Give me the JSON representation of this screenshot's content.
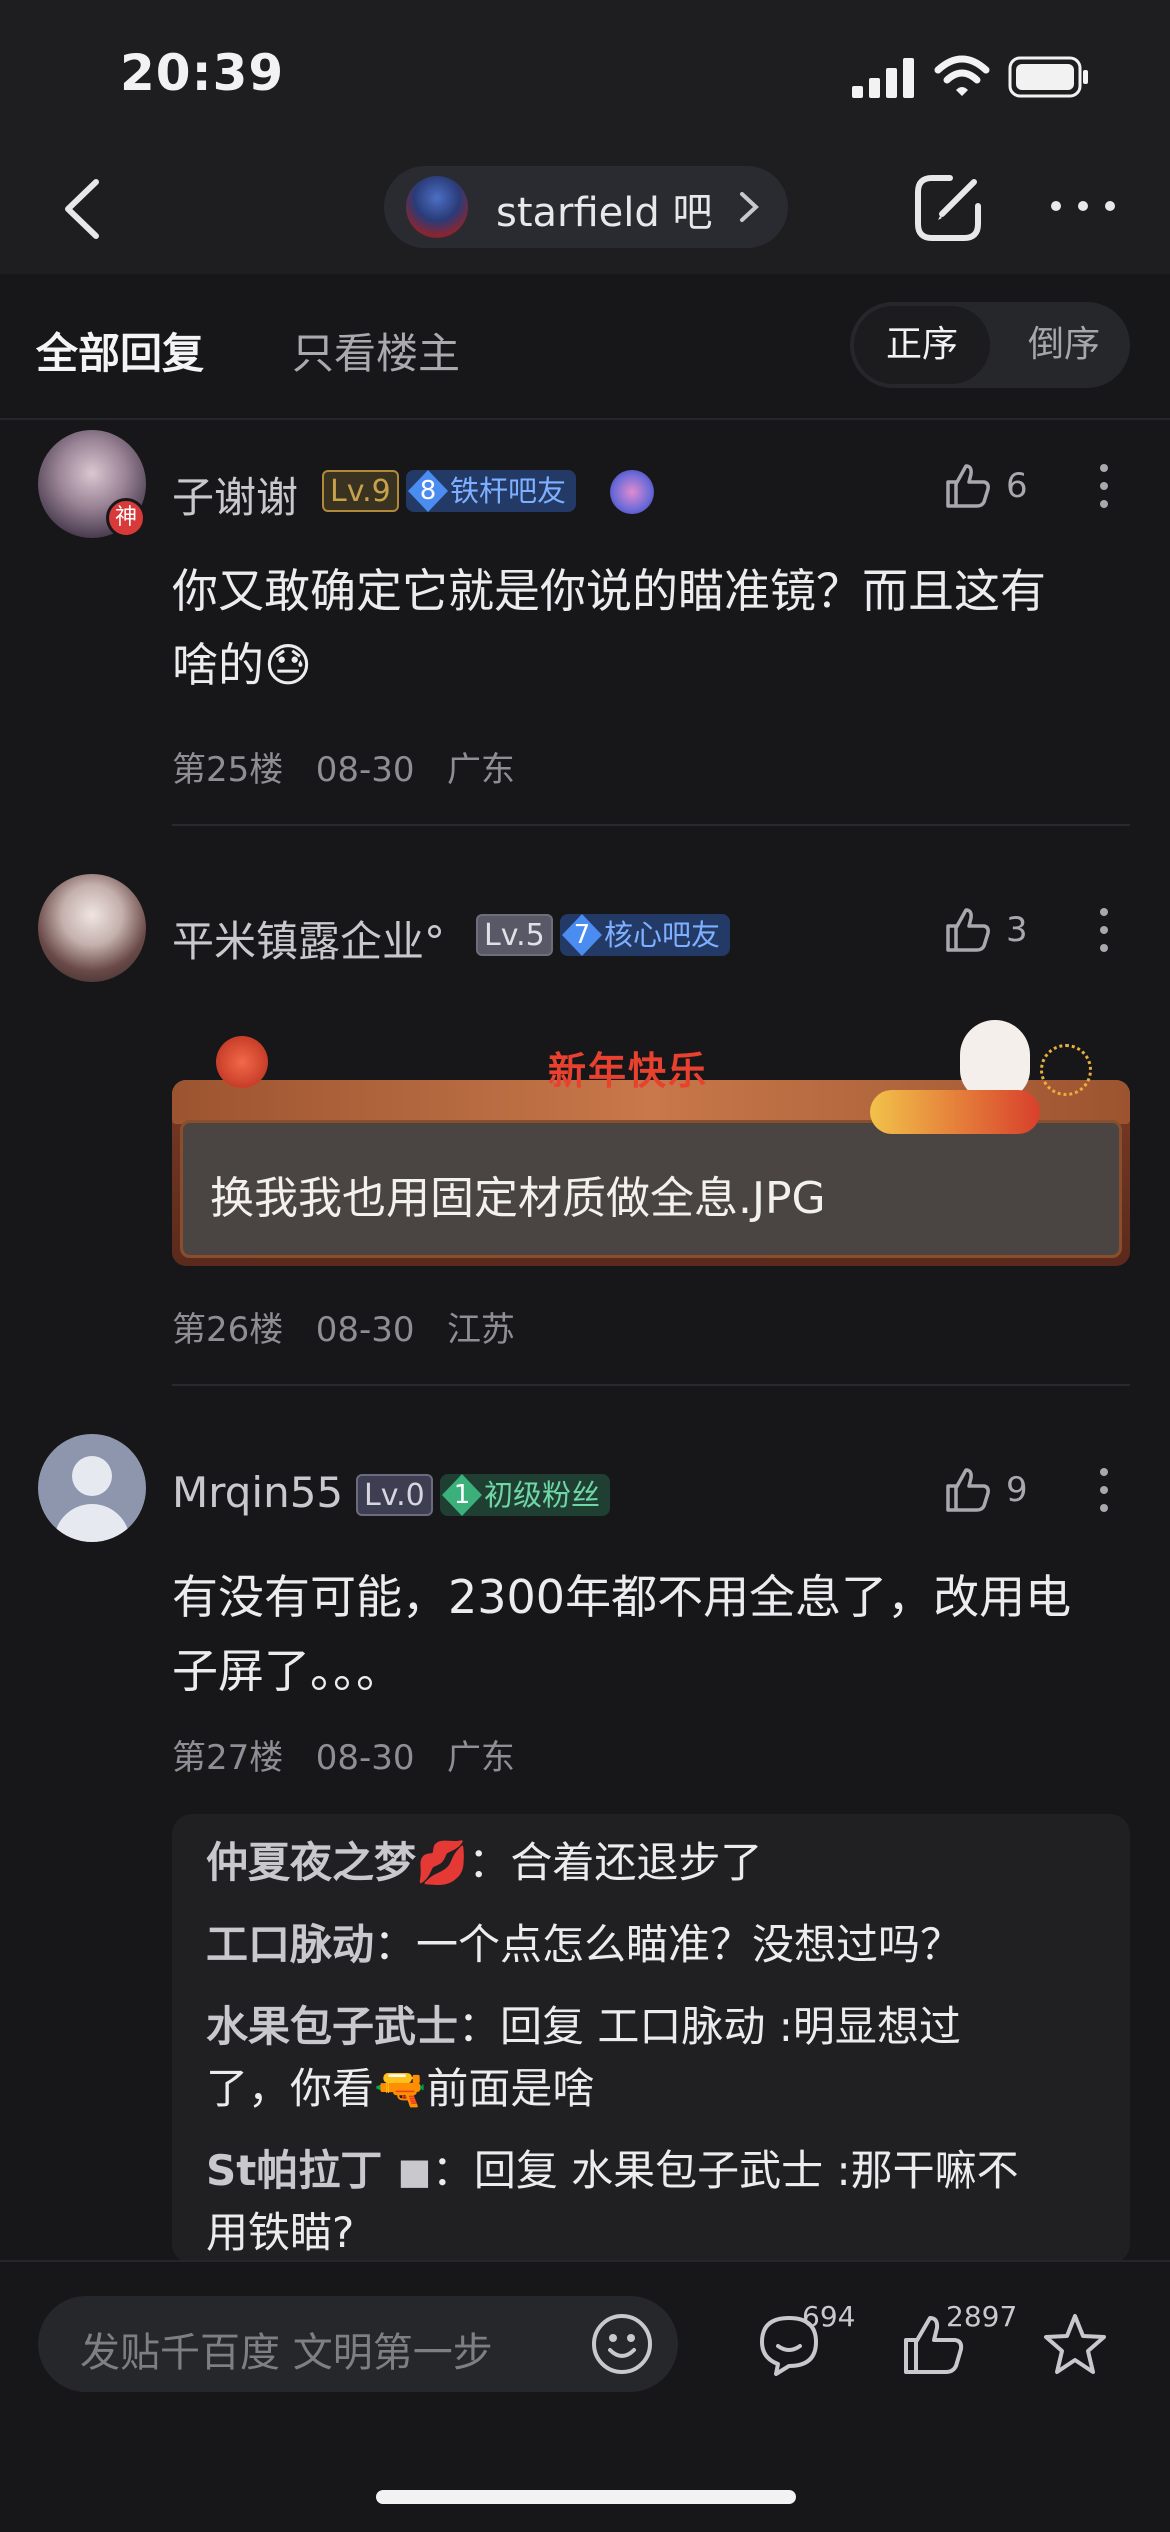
{
  "status_bar": {
    "time": "20:39"
  },
  "nav": {
    "forum_name": "starfield 吧"
  },
  "tabs": {
    "all": "全部回复",
    "op_only": "只看楼主",
    "sort_asc": "正序",
    "sort_desc": "倒序"
  },
  "comments": [
    {
      "username": "子谢谢",
      "level": "Lv.9",
      "badge_num": "8",
      "badge_text": "铁杆吧友",
      "avatar_tag": "神",
      "likes": "6",
      "text_line1": "你又敢确定它就是你说的瞄准镜？而且这有",
      "text_line2": "啥的",
      "text_emoji": "😓",
      "floor": "第25楼",
      "date": "08-30",
      "location": "广东"
    },
    {
      "username": "平米镇露企业°",
      "level": "Lv.5",
      "badge_num": "7",
      "badge_text": "核心吧友",
      "likes": "3",
      "banner_text": "新年快乐",
      "text": "换我我也用固定材质做全息.JPG",
      "floor": "第26楼",
      "date": "08-30",
      "location": "江苏"
    },
    {
      "username": "Mrqin55",
      "level": "Lv.0",
      "badge_num": "1",
      "badge_text": "初级粉丝",
      "likes": "9",
      "text_line1": "有没有可能，2300年都不用全息了，改用电",
      "text_line2": "子屏了。。。",
      "floor": "第27楼",
      "date": "08-30",
      "location": "广东"
    }
  ],
  "replies": [
    {
      "user": "仲夏夜之梦💋",
      "sep": "：",
      "text": "合着还退步了"
    },
    {
      "user": "工口脉动",
      "sep": "：",
      "text": "一个点怎么瞄准？没想过吗？"
    },
    {
      "user": "水果包子武士",
      "sep": "：",
      "text_line1": "回复 工口脉动 :明显想过",
      "text_line2a": "了，你看",
      "text_emoji": "🔫",
      "text_line2b": "前面是啥"
    },
    {
      "user": "St帕拉丁 ◼",
      "sep": "：",
      "text_line1": "回复 水果包子武士 :那干嘛不",
      "text_line2": "用铁瞄?"
    }
  ],
  "bottom_bar": {
    "input_placeholder": "发贴千百度 文明第一步",
    "comment_count": "694",
    "like_count": "2897"
  },
  "colors": {
    "background": "#17171a",
    "lv9_gold": "#c8a24a",
    "badge_blue": "#4a8cf0",
    "badge_green": "#3bb07a"
  },
  "icons": [
    "signal-icon",
    "wifi-icon",
    "battery-icon",
    "back-icon",
    "chevron-right-icon",
    "edit-icon",
    "more-icon",
    "like-icon",
    "kebab-icon",
    "emoji-icon",
    "comment-icon",
    "star-icon"
  ]
}
